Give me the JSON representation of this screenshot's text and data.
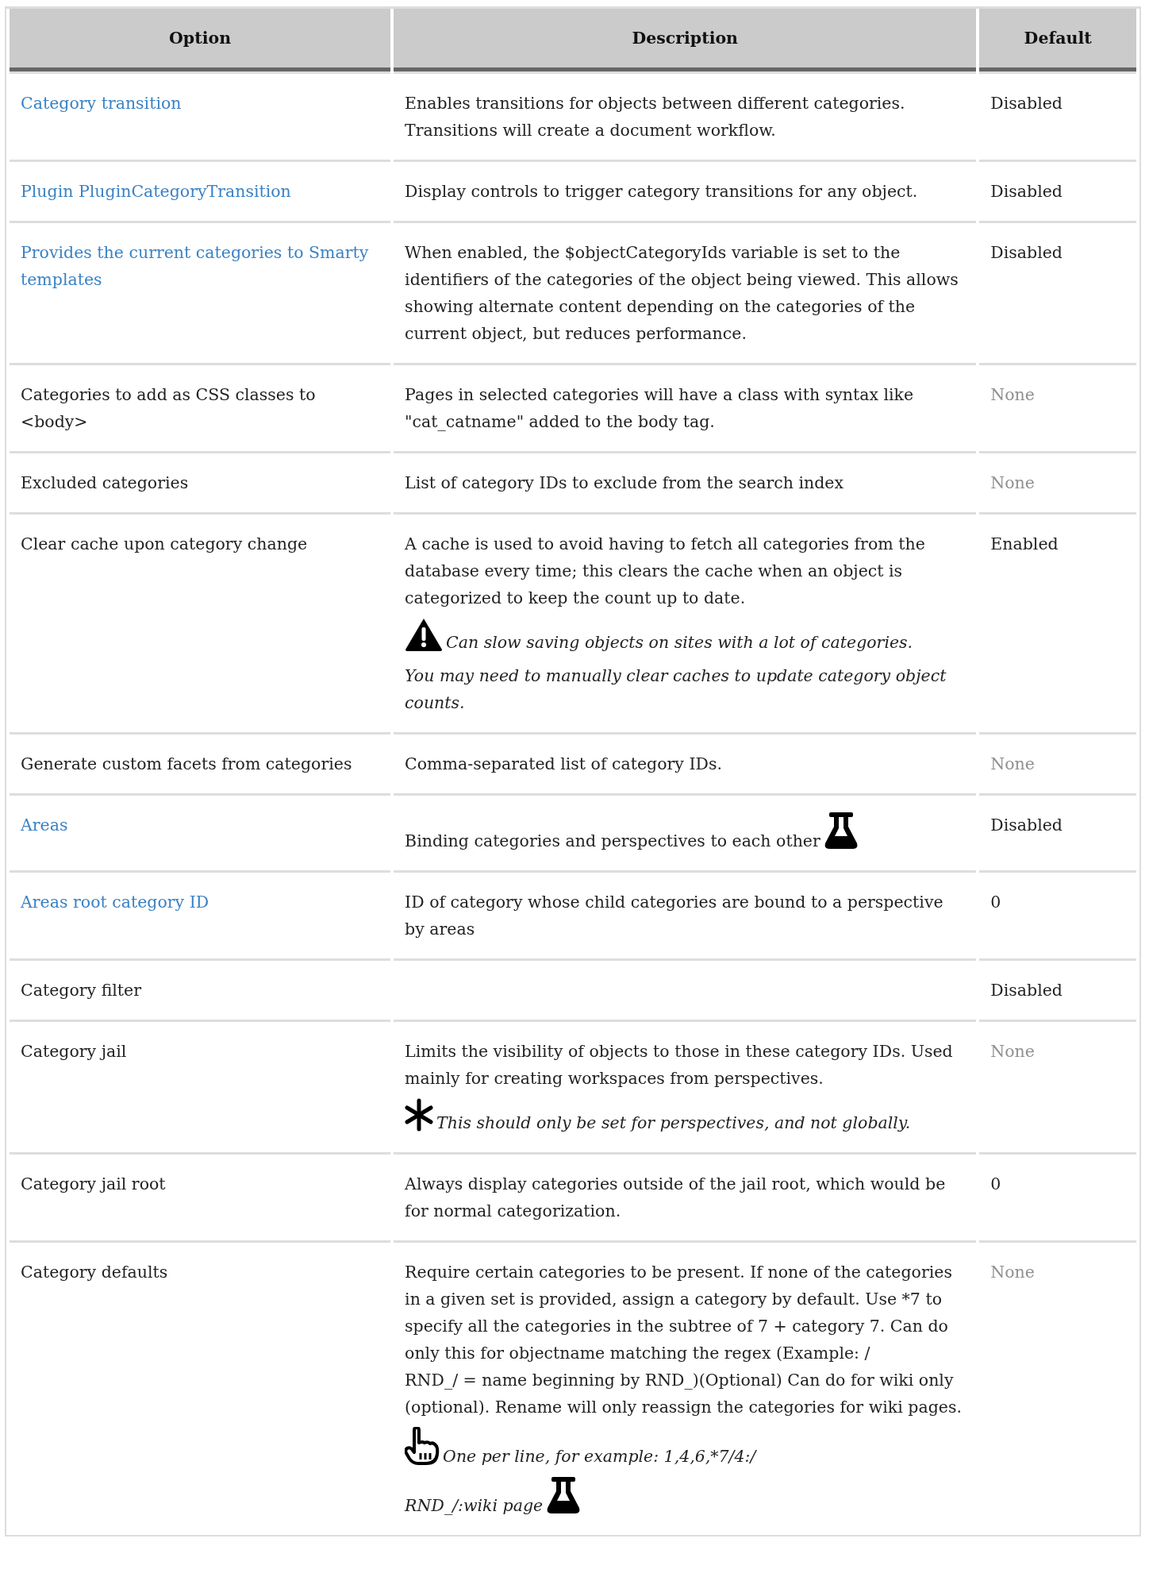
{
  "table": {
    "columns": [
      "Option",
      "Description",
      "Default"
    ],
    "rows": [
      {
        "option": {
          "text": "Category transition",
          "link": true
        },
        "description": [
          {
            "kind": "plain",
            "text": "Enables transitions for objects between different categories. Transitions will create a document workflow."
          }
        ],
        "default": {
          "text": "Disabled",
          "muted": false
        }
      },
      {
        "option": {
          "text": "Plugin PluginCategoryTransition",
          "link": true
        },
        "description": [
          {
            "kind": "plain",
            "text": "Display controls to trigger category transitions for any object."
          }
        ],
        "default": {
          "text": "Disabled",
          "muted": false
        }
      },
      {
        "option": {
          "text": "Provides the current categories to Smarty templates",
          "link": true
        },
        "description": [
          {
            "kind": "plain",
            "text": "When enabled, the $objectCategoryIds variable is set to the identifiers of the categories of the object being viewed. This allows showing alternate content depending on the categories of the current object, but reduces performance."
          }
        ],
        "default": {
          "text": "Disabled",
          "muted": false
        }
      },
      {
        "option": {
          "text": "Categories to add as CSS classes to <body>",
          "link": false
        },
        "description": [
          {
            "kind": "plain",
            "text": "Pages in selected categories will have a class with syntax like \"cat_catname\" added to the body tag."
          }
        ],
        "default": {
          "text": "None",
          "muted": true
        }
      },
      {
        "option": {
          "text": "Excluded categories",
          "link": false
        },
        "description": [
          {
            "kind": "plain",
            "text": "List of category IDs to exclude from the search index"
          }
        ],
        "default": {
          "text": "None",
          "muted": true
        }
      },
      {
        "option": {
          "text": "Clear cache upon category change",
          "link": false
        },
        "description": [
          {
            "kind": "plain",
            "text": "A cache is used to avoid having to fetch all categories from the database every time; this clears the cache when an object is categorized to keep the count up to date."
          },
          {
            "kind": "warning-note",
            "text": "Can slow saving objects on sites with a lot of categories."
          },
          {
            "kind": "note",
            "text": "You may need to manually clear caches to update category object counts."
          }
        ],
        "default": {
          "text": "Enabled",
          "muted": false
        }
      },
      {
        "option": {
          "text": "Generate custom facets from categories",
          "link": false
        },
        "description": [
          {
            "kind": "plain",
            "text": "Comma-separated list of category IDs."
          }
        ],
        "default": {
          "text": "None",
          "muted": true
        }
      },
      {
        "option": {
          "text": "Areas",
          "link": true
        },
        "description": [
          {
            "kind": "flask-text",
            "text": "Binding categories and perspectives to each other"
          }
        ],
        "default": {
          "text": "Disabled",
          "muted": false
        }
      },
      {
        "option": {
          "text": "Areas root category ID",
          "link": true
        },
        "description": [
          {
            "kind": "plain",
            "text": "ID of category whose child categories are bound to a perspective by areas"
          }
        ],
        "default": {
          "text": "0",
          "muted": false
        }
      },
      {
        "option": {
          "text": "Category filter",
          "link": false
        },
        "description": [],
        "default": {
          "text": "Disabled",
          "muted": false
        }
      },
      {
        "option": {
          "text": "Category jail",
          "link": false
        },
        "description": [
          {
            "kind": "plain",
            "text": "Limits the visibility of objects to those in these category IDs. Used mainly for creating workspaces from perspectives."
          },
          {
            "kind": "asterisk-note",
            "text": "This should only be set for perspectives, and not globally."
          }
        ],
        "default": {
          "text": "None",
          "muted": true
        }
      },
      {
        "option": {
          "text": "Category jail root",
          "link": false
        },
        "description": [
          {
            "kind": "plain",
            "text": "Always display categories outside of the jail root, which would be for normal categorization."
          }
        ],
        "default": {
          "text": "0",
          "muted": false
        }
      },
      {
        "option": {
          "text": "Category defaults",
          "link": false
        },
        "description": [
          {
            "kind": "plain",
            "text": "Require certain categories to be present. If none of the categories in a given set is provided, assign a category by default. Use *7 to specify all the categories in the subtree of 7 + category 7. Can do only this for objectname matching the regex (Example: /\nRND_/ = name beginning by RND_)(Optional) Can do for wiki only (optional). Rename will only reassign the categories for wiki pages."
          },
          {
            "kind": "pointer-note",
            "text": "One per line, for example: 1,4,6,*7/4:/"
          },
          {
            "kind": "flask-note",
            "text": "RND_/:wiki page"
          }
        ],
        "default": {
          "text": "None",
          "muted": true
        }
      }
    ]
  }
}
